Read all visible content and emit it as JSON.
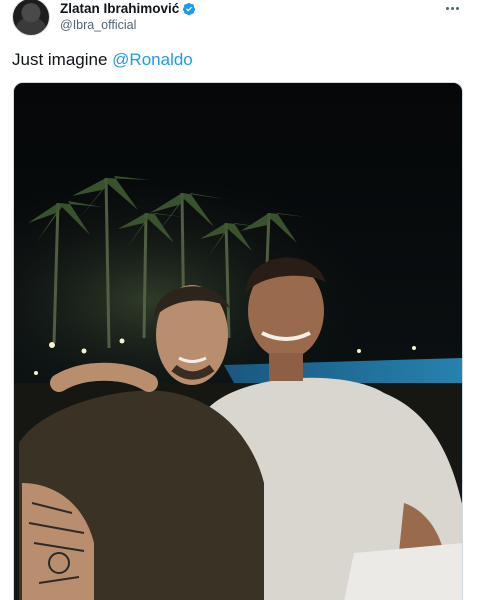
{
  "author": {
    "display_name": "Zlatan Ibrahimović",
    "handle": "@Ibra_official",
    "verified": true
  },
  "tweet": {
    "text_prefix": "Just imagine ",
    "mention": "@Ronaldo"
  },
  "colors": {
    "link": "#1d9bf0",
    "verified_badge": "#1d9bf0",
    "secondary_text": "#536471"
  },
  "icons": {
    "more": "more-horizontal-icon",
    "verified": "verified-badge-icon"
  }
}
